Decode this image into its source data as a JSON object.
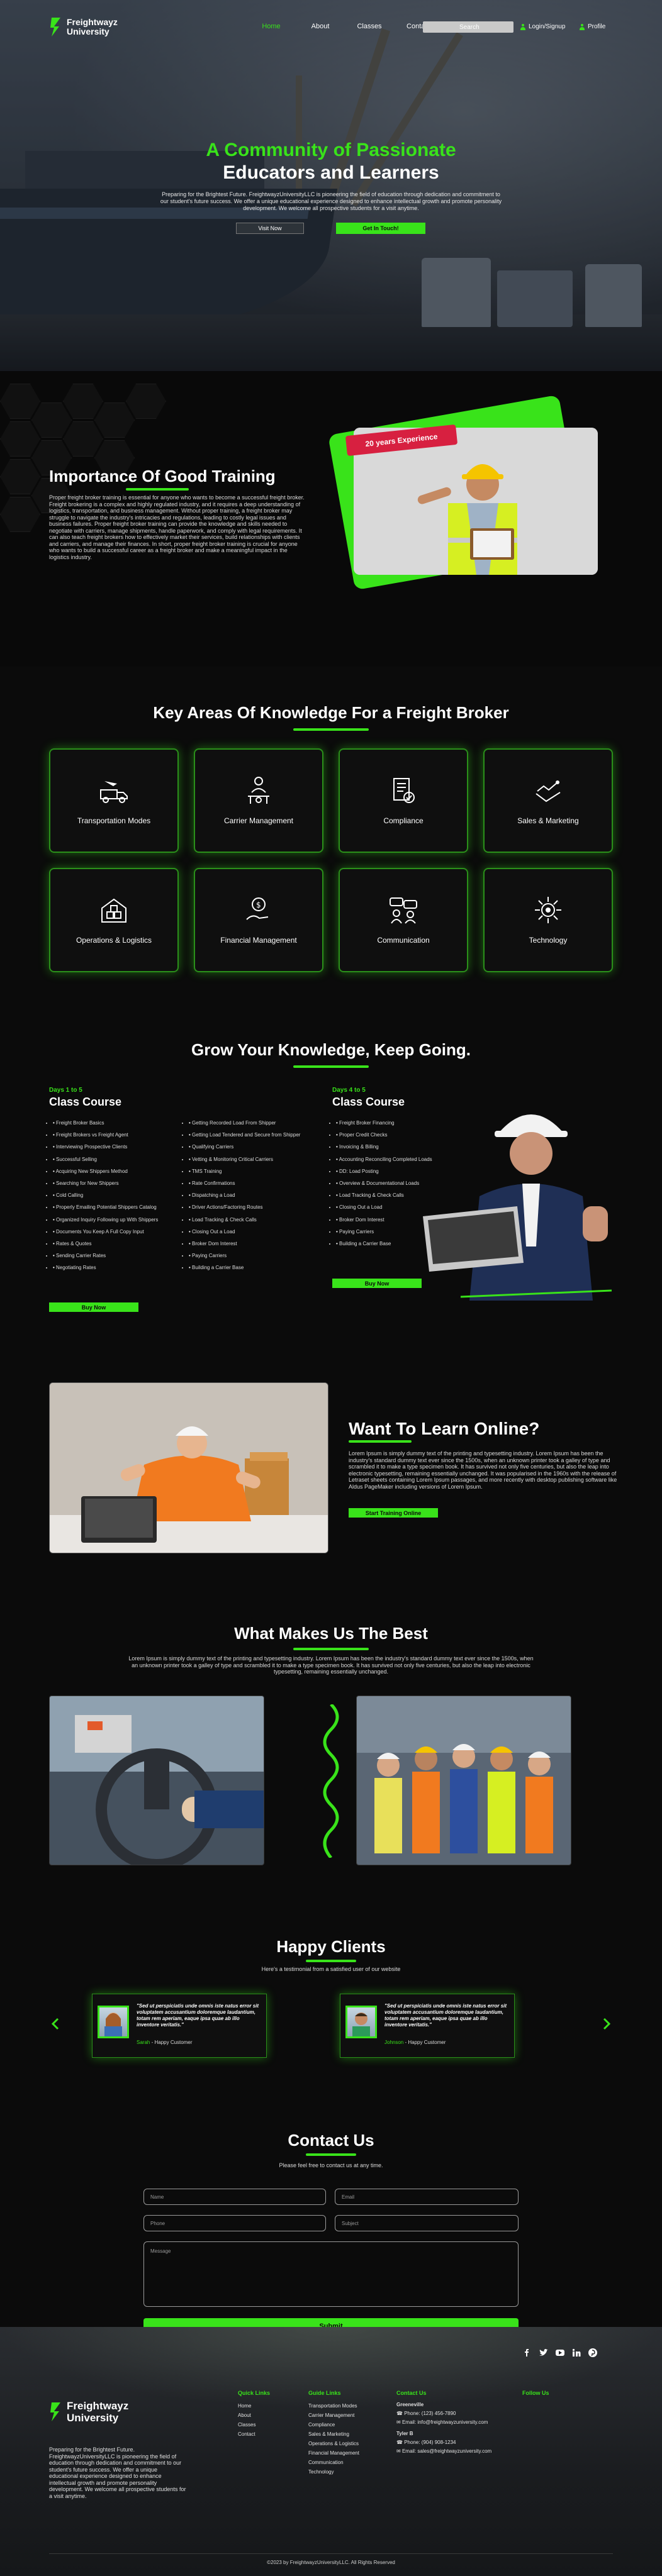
{
  "brand": {
    "name_line1": "Freightwayz",
    "name_line2": "University",
    "accent": "#39e31a"
  },
  "nav": {
    "links": [
      "Home",
      "About",
      "Classes",
      "Contact"
    ],
    "search_placeholder": "Search",
    "login": "Login/Signup",
    "profile": "Profile"
  },
  "hero": {
    "title_line1": "A Community of Passionate",
    "title_line2": "Educators and Learners",
    "paragraph": "Preparing for the Brightest Future. FreightwayzUniversityLLC is pioneering the field of education through dedication and commitment to our student's future success. We offer a unique educational experience designed to enhance intellectual growth and promote personality development. We welcome all prospective students for a visit anytime.",
    "btn_visit": "Visit Now",
    "btn_touch": "Get In Touch!"
  },
  "training": {
    "title": "Importance Of Good Training",
    "paragraph": "Proper freight broker training is essential for anyone who wants to become a successful freight broker. Freight brokering is a complex and highly regulated industry, and it requires a deep understanding of logistics, transportation, and business management. Without proper training, a freight broker may struggle to navigate the industry's intricacies and regulations, leading to costly legal issues and business failures. Proper freight broker training can provide the knowledge and skills needed to negotiate with carriers, manage shipments, handle paperwork, and comply with legal requirements. It can also teach freight brokers how to effectively market their services, build relationships with clients and carriers, and manage their finances. In short, proper freight broker training is crucial for anyone who wants to build a successful career as a freight broker and make a meaningful impact in the logistics industry.",
    "badge": "20 years Experience"
  },
  "knowledge": {
    "title": "Key Areas Of Knowledge For a Freight Broker",
    "cards": [
      {
        "label": "Transportation Modes",
        "icon": "transport-icon"
      },
      {
        "label": "Carrier Management",
        "icon": "carrier-icon"
      },
      {
        "label": "Compliance",
        "icon": "compliance-icon"
      },
      {
        "label": "Sales & Marketing",
        "icon": "sales-icon"
      },
      {
        "label": "Operations & Logistics",
        "icon": "operations-icon"
      },
      {
        "label": "Financial Management",
        "icon": "finance-icon"
      },
      {
        "label": "Communication",
        "icon": "communication-icon"
      },
      {
        "label": "Technology",
        "icon": "technology-icon"
      }
    ]
  },
  "courses": {
    "title": "Grow Your Knowledge, Keep Going.",
    "course1": {
      "days": "Days 1 to 5",
      "title": "Class Course",
      "col1": [
        "Freight Broker Basics",
        "Freight Brokers vs Freight Agent",
        "Interviewing Prospective Clients",
        "Successful Selling",
        "Acquiring New Shippers Method",
        "Searching for New Shippers",
        "Cold Calling",
        "Properly Emailing Potential Shippers Catalog",
        "Organized Inquiry Following up With Shippers",
        "Documents You Keep A Full Copy Input",
        "Rates & Quotes",
        "Sending Carrier Rates",
        "Negotiating Rates"
      ],
      "col2": [
        "Getting Recorded Load From Shipper",
        "Getting Load Tendered and Secure from Shipper",
        "Qualifying Carriers",
        "Vetting & Monitoring Critical Carriers",
        "TMS Training",
        "Rate Confirmations",
        "Dispatching a Load",
        "Driver Actions/Factoring Routes",
        "Load Tracking & Check Calls",
        "Closing Out a Load",
        "Broker Dom Interest",
        "Paying Carriers",
        "Building a Carrier Base"
      ],
      "buy": "Buy Now"
    },
    "course2": {
      "days": "Days 4 to 5",
      "title": "Class Course",
      "col1": [
        "Freight Broker Financing",
        "Proper Credit Checks",
        "Invoicing & Billing",
        "Accounting Reconciling Completed Loads",
        "DD: Load Posting",
        "Overview & Documentational Loads",
        "Load Tracking & Check Calls",
        "Closing Out a Load",
        "Broker Dom Interest",
        "Paying Carriers",
        "Building a Carrier Base"
      ],
      "buy": "Buy Now"
    }
  },
  "online": {
    "title": "Want To Learn Online?",
    "paragraph": "Lorem Ipsum is simply dummy text of the printing and typesetting industry. Lorem Ipsum has been the industry's standard dummy text ever since the 1500s, when an unknown printer took a galley of type and scrambled it to make a type specimen book. It has survived not only five centuries, but also the leap into electronic typesetting, remaining essentially unchanged. It was popularised in the 1960s with the release of Letraset sheets containing Lorem Ipsum passages, and more recently with desktop publishing software like Aldus PageMaker including versions of Lorem Ipsum.",
    "button": "Start Training Online"
  },
  "best": {
    "title": "What Makes Us The Best",
    "paragraph": "Lorem Ipsum is simply dummy text of the printing and typesetting industry. Lorem Ipsum has been the industry's standard dummy text ever since the 1500s, when an unknown printer took a galley of type and scrambled it to make a type specimen book. It has survived not only five centuries, but also the leap into electronic typesetting, remaining essentially unchanged."
  },
  "clients": {
    "title": "Happy Clients",
    "subtitle": "Here's a testimonial from a satisfied user of our website",
    "testimonials": [
      {
        "quote": "\"Sed ut perspiciatis unde omnis iste natus error sit voluptatem accusantium doloremque laudantium, totam rem aperiam, eaque ipsa quae ab illo inventore veritatis.\"",
        "name": "Sarah",
        "role": " - Happy Customer"
      },
      {
        "quote": "\"Sed ut perspiciatis unde omnis iste natus error sit voluptatem accusantium doloremque laudantium, totam rem aperiam, eaque ipsa quae ab illo inventore veritatis.\"",
        "name": "Johnson",
        "role": " - Happy Customer"
      }
    ]
  },
  "contact": {
    "title": "Contact Us",
    "subtitle": "Please feel free to contact us at any time.",
    "name_ph": "Name",
    "email_ph": "Email",
    "phone_ph": "Phone",
    "subject_ph": "Subject",
    "message_ph": "Message",
    "submit": "Submit"
  },
  "footer": {
    "about": "Preparing for the Brightest Future. FreightwayzUniversityLLC is pioneering the field of education through dedication and commitment to our student's future success. We offer a unique educational experience designed to enhance intellectual growth and promote personality development. We welcome all prospective students for a visit anytime.",
    "quick_links_title": "Quick Links",
    "quick_links": [
      "Home",
      "About",
      "Classes",
      "Contact"
    ],
    "guide_title": "Guide Links",
    "guide_links": [
      "Transportation Modes",
      "Carrier Management",
      "Compliance",
      "Sales & Marketing",
      "Operations & Logistics",
      "Financial Management",
      "Communication",
      "Technology"
    ],
    "contact_title": "Contact Us",
    "office1": "Greeneville",
    "phone1_label": "Phone:",
    "phone1": "(123) 456-7890",
    "email1_label": "Email:",
    "email1": "info@freightwayzuniversity.com",
    "office2": "Tyler B",
    "phone2_label": "Phone:",
    "phone2": "(904) 908-1234",
    "email2_label": "Email:",
    "email2": "sales@freightwayzuniversity.com",
    "follow_title": "Follow Us",
    "copyright": "©2023 by FreightwayzUniversityLLC. All Rights Reserved"
  }
}
